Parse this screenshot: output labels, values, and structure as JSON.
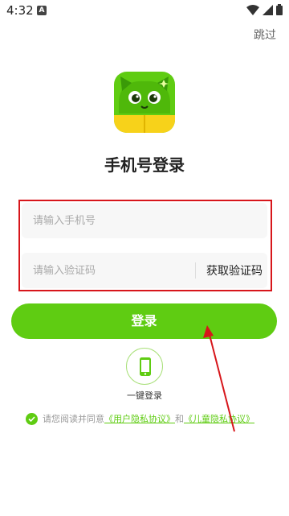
{
  "status_bar": {
    "time": "4:32",
    "notif_badge": "A"
  },
  "header": {
    "skip_label": "跳过"
  },
  "main": {
    "title": "手机号登录"
  },
  "form": {
    "phone_placeholder": "请输入手机号",
    "code_placeholder": "请输入验证码",
    "get_code_label": "获取验证码",
    "login_label": "登录"
  },
  "one_key": {
    "label": "一键登录"
  },
  "agreement": {
    "prefix": "请您阅读并同意",
    "user_privacy": "《用户隐私协议》",
    "and": "和",
    "child_privacy": "《儿童隐私协议》",
    "checked": true
  },
  "colors": {
    "accent": "#5fcc12",
    "highlight": "#d7161b"
  }
}
